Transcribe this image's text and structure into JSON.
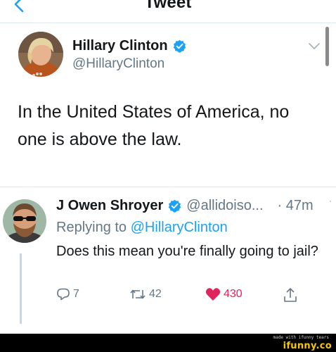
{
  "nav": {
    "title": "Tweet"
  },
  "tweet": {
    "author_name": "Hillary Clinton",
    "author_handle": "@HillaryClinton",
    "text": "In the United States of America, no one is above the law."
  },
  "reply": {
    "author_name": "J Owen Shroyer",
    "author_handle": "@allidoiso...",
    "time": "· 47m",
    "replying_to_label": "Replying to",
    "replying_to_handle": "@HillaryClinton",
    "text": "Does this mean you're finally going to jail?",
    "reply_count": "7",
    "retweet_count": "42",
    "like_count": "430"
  },
  "footer": {
    "small_text": "made with ifunny tears",
    "logo_text": "ifunny.co"
  },
  "colors": {
    "accent": "#1da1f2",
    "like": "#e0245e",
    "secondary_text": "#657786"
  }
}
